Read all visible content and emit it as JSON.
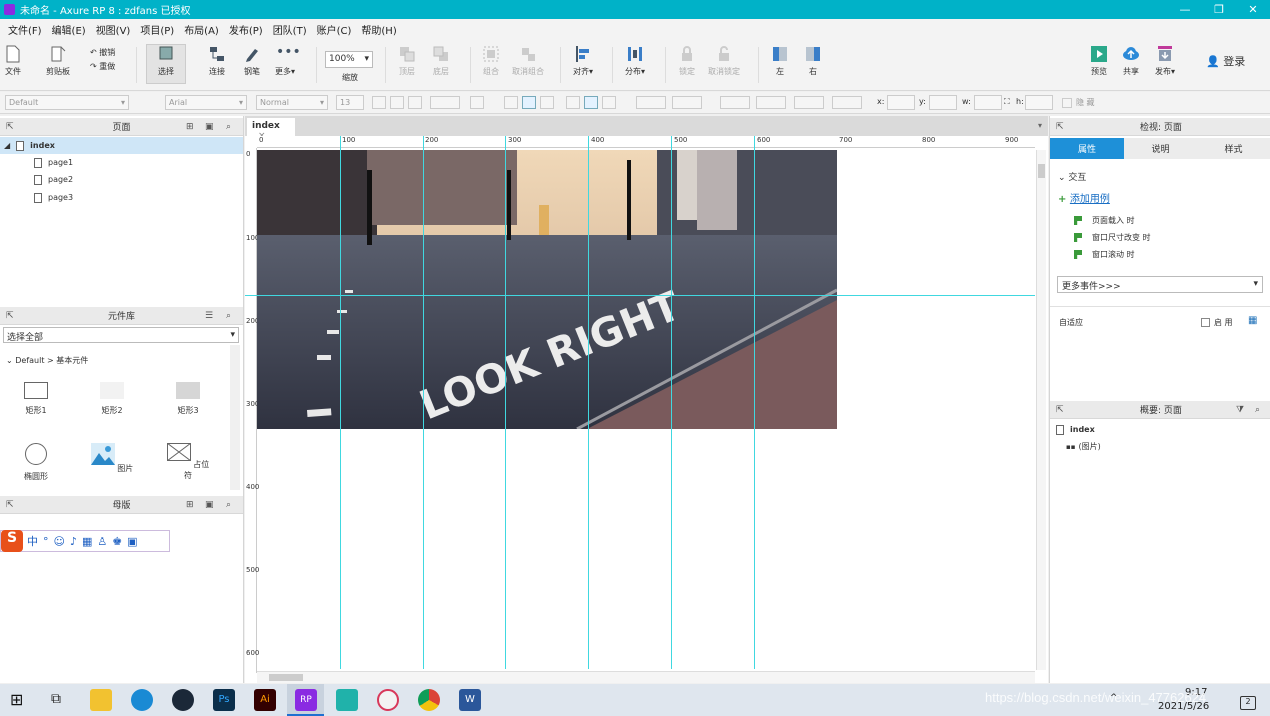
{
  "titlebar": {
    "title": "未命名 - Axure RP 8 : zdfans 已授权",
    "minimize": "—",
    "restore": "❐",
    "close": "✕"
  },
  "menu": [
    "文件(F)",
    "编辑(E)",
    "视图(V)",
    "项目(P)",
    "布局(A)",
    "发布(P)",
    "团队(T)",
    "账户(C)",
    "帮助(H)"
  ],
  "toolbar": {
    "file": "文件",
    "clipboard": "剪贴板",
    "undo": "撤销",
    "redo": "重做",
    "select": "选择",
    "connect": "连接",
    "pen": "钢笔",
    "more": "更多▾",
    "zoom_value": "100%",
    "zoom_label": "缩放",
    "front": "顶层",
    "back": "底层",
    "group": "组合",
    "ungroup": "取消组合",
    "align": "对齐▾",
    "distribute": "分布▾",
    "lock": "锁定",
    "unlock": "取消锁定",
    "left": "左",
    "right": "右",
    "preview": "预览",
    "share": "共享",
    "publish": "发布▾",
    "login": "登录"
  },
  "formatbar": {
    "style": "Default",
    "font": "Arial",
    "weight": "Normal",
    "size": "13",
    "x_label": "x:",
    "y_label": "y:",
    "w_label": "w:",
    "h_label": "h:",
    "hidden_label": "隐 藏"
  },
  "pages_panel": {
    "title": "页面",
    "root": "index",
    "children": [
      "page1",
      "page2",
      "page3"
    ]
  },
  "library_panel": {
    "title": "元件库",
    "select": "选择全部",
    "group": "Default > 基本元件",
    "widgets": [
      "矩形1",
      "矩形2",
      "矩形3",
      "椭圆形",
      "图片",
      "占位符"
    ]
  },
  "masters_panel": {
    "title": "母版"
  },
  "canvas": {
    "tab": "index",
    "ruler_h": [
      "0",
      "100",
      "200",
      "300",
      "400",
      "500",
      "600",
      "700",
      "800",
      "900"
    ],
    "ruler_v": [
      "0",
      "100",
      "200",
      "300",
      "400",
      "500",
      "600"
    ],
    "photo_text": "LOOK RIGHT"
  },
  "inspector": {
    "title": "检视: 页面",
    "tabs": [
      "属性",
      "说明",
      "样式"
    ],
    "section": "交互",
    "add_case": "添加用例",
    "events": [
      "页面载入 时",
      "窗口尺寸改变 时",
      "窗口滚动 时"
    ],
    "more_events": "更多事件>>>",
    "adaptive": "自适应",
    "enable": "启 用"
  },
  "outline": {
    "title": "概要: 页面",
    "root": "index",
    "child": "(图片)"
  },
  "taskbar": {
    "time": "9:17",
    "date": "2021/5/26",
    "notif": "2"
  },
  "watermark": "https://blog.csdn.net/weixin_47762624",
  "colors": {
    "titlebar": "#00b2c8",
    "guide": "#40d8e0",
    "tab_active": "#1e90d8",
    "link": "#1a6fc4"
  }
}
